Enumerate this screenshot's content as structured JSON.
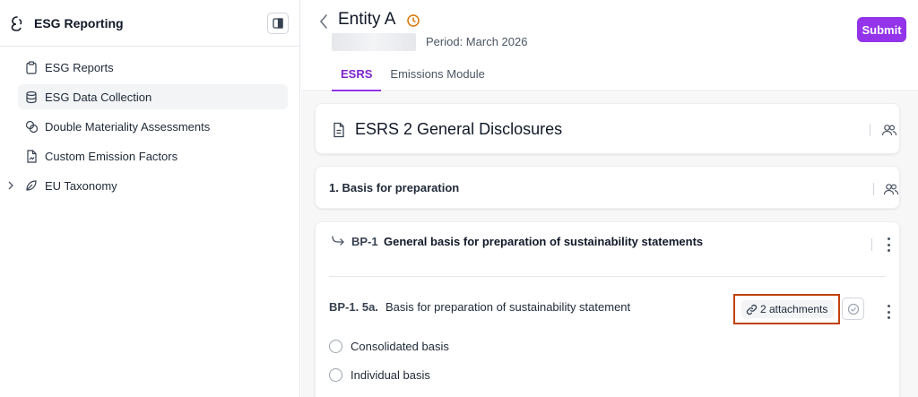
{
  "app": {
    "title": "ESG Reporting"
  },
  "sidebar": {
    "items": [
      {
        "label": "ESG Reports",
        "icon": "clipboard-icon",
        "active": false
      },
      {
        "label": "ESG Data Collection",
        "icon": "database-icon",
        "active": true
      },
      {
        "label": "Double Materiality Assessments",
        "icon": "circles-icon",
        "active": false
      },
      {
        "label": "Custom Emission Factors",
        "icon": "file-chart-icon",
        "active": false
      },
      {
        "label": "EU Taxonomy",
        "icon": "leaf-icon",
        "active": false,
        "expandable": true
      }
    ]
  },
  "header": {
    "entity": "Entity A",
    "period": "Period: March 2026",
    "submit_label": "Submit",
    "tabs": [
      {
        "label": "ESRS",
        "active": true
      },
      {
        "label": "Emissions Module",
        "active": false
      }
    ]
  },
  "content": {
    "disclosure_title": "ESRS 2 General Disclosures",
    "section_title": "1. Basis for preparation",
    "bp": {
      "code": "BP-1",
      "title": "General basis for preparation of sustainability statements"
    },
    "question": {
      "code": "BP-1. 5a.",
      "text": "Basis for preparation of sustainability statement",
      "attachments_label": "2 attachments",
      "options": [
        "Consolidated basis",
        "Individual basis"
      ]
    }
  },
  "colors": {
    "accent": "#9333ea",
    "highlight_border": "#c2410c"
  }
}
